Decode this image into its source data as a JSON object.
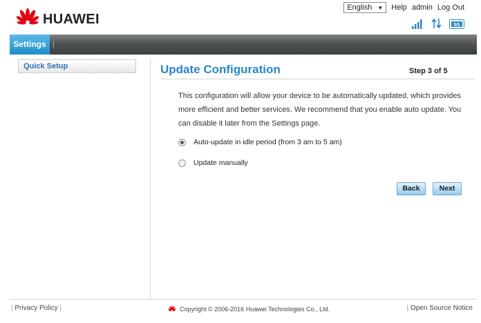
{
  "header": {
    "brand": "HUAWEI",
    "language": "English",
    "links": [
      "Help",
      "admin",
      "Log Out"
    ]
  },
  "status": {
    "network_badge": "5G"
  },
  "nav": {
    "active_tab": "Settings"
  },
  "sidebar": {
    "items": [
      {
        "label": "Quick Setup"
      }
    ]
  },
  "main": {
    "title": "Update Configuration",
    "step": "Step 3 of 5",
    "description": "This configuration will allow your device to be automatically updated, which provides more efficient and better services. We recommend that you enable auto update. You can disable it later from the Settings page.",
    "options": [
      {
        "label": "Auto-update in idle period (from 3 am to 5 am)",
        "selected": true
      },
      {
        "label": "Update manually",
        "selected": false
      }
    ],
    "back_label": "Back",
    "next_label": "Next"
  },
  "footer": {
    "privacy": "Privacy Policy",
    "copyright": "Copyright © 2006-2016 Huawei Technologies Co., Ltd.",
    "open_source": "Open Source Notice"
  },
  "colors": {
    "accent": "#2a86c6",
    "brand_red": "#e60012",
    "nav_active": "#1d8dcc"
  }
}
